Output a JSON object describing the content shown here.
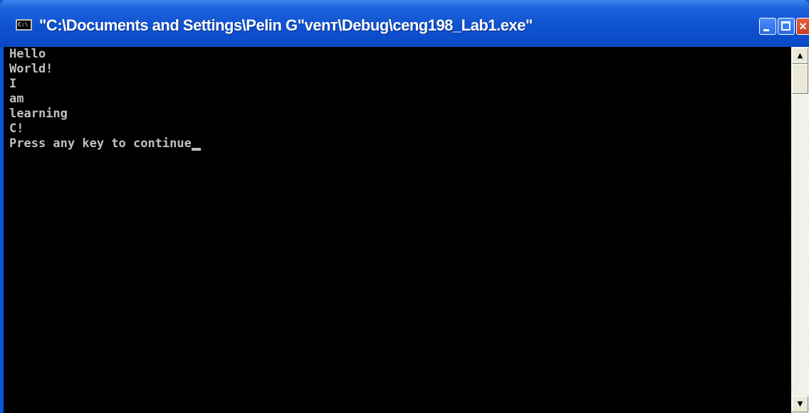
{
  "window": {
    "title": "\"C:\\Documents and Settings\\Pelin G\"venт\\Debug\\ceng198_Lab1.exe\"",
    "icon_name": "console-app-icon",
    "icon_glyph": "C:\\",
    "buttons": {
      "minimize_icon": "minimize-icon",
      "maximize_icon": "maximize-icon",
      "close_icon": "close-icon",
      "close_glyph": "×"
    }
  },
  "console": {
    "background": "#000000",
    "text_color": "#c0c0c0",
    "lines": [
      "Hello",
      "World!",
      "I",
      "am",
      "learning",
      "C!",
      "Press any key to continue"
    ]
  },
  "scrollbar": {
    "up_glyph": "▲",
    "down_glyph": "▼"
  },
  "colors": {
    "titlebar": "#0a56d6",
    "close_button": "#c8401e"
  }
}
